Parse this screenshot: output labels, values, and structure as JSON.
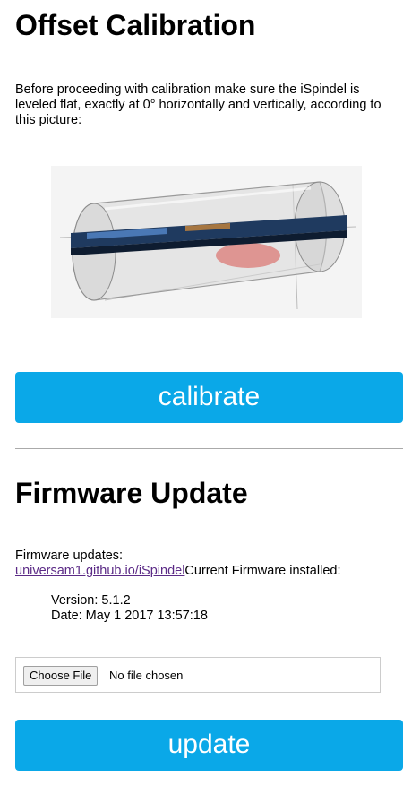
{
  "calibration": {
    "title": "Offset Calibration",
    "text": "Before proceeding with calibration make sure the iSpindel is leveled flat, exactly at 0° horizontally and vertically, according to this picture:",
    "button_label": "calibrate"
  },
  "firmware": {
    "title": "Firmware Update",
    "updates_label": "Firmware updates:",
    "link_text": "universam1.github.io/iSpindel",
    "installed_label": "Current Firmware installed:",
    "version": "Version: 5.1.2",
    "date": "Date: May 1 2017 13:57:18",
    "choose_file_label": "Choose File",
    "file_status": "No file chosen",
    "button_label": "update"
  },
  "colors": {
    "button": "#0aa8e8",
    "link": "#5b2a86"
  }
}
